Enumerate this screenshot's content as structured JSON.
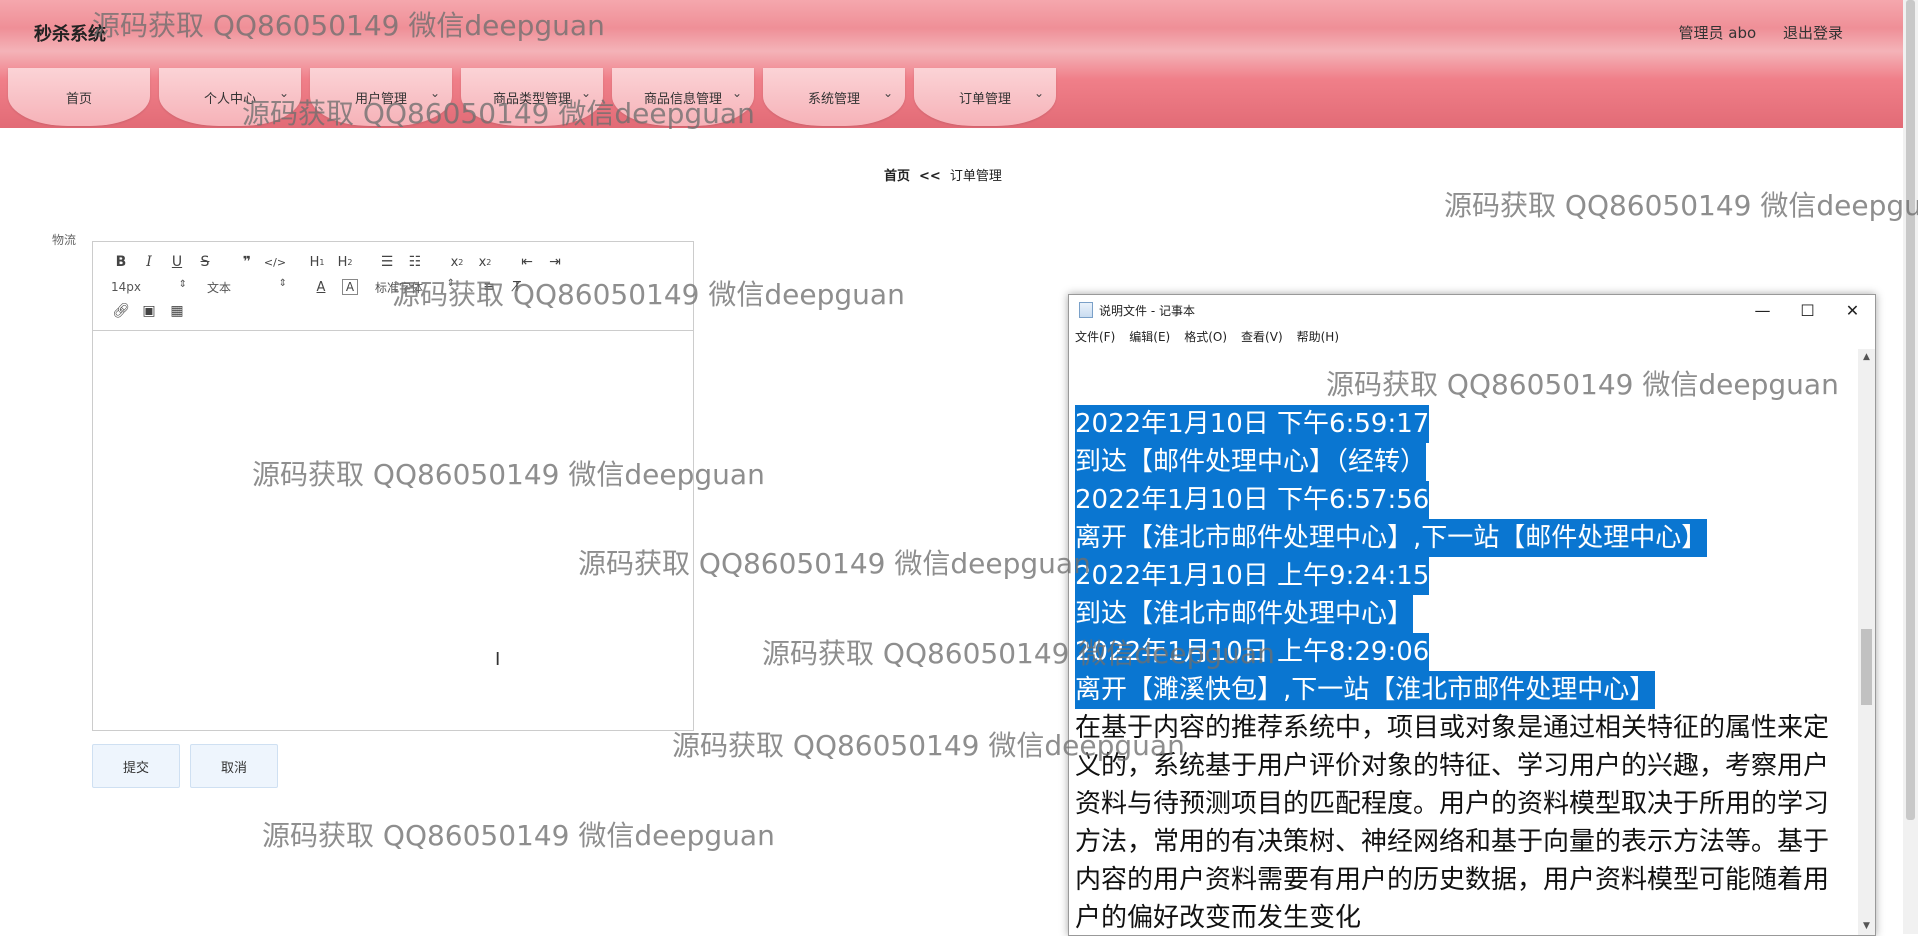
{
  "header": {
    "brand": "秒杀系统",
    "user_label": "管理员 abo",
    "logout_label": "退出登录"
  },
  "nav": [
    {
      "label": "首页",
      "has_dropdown": false
    },
    {
      "label": "个人中心",
      "has_dropdown": true
    },
    {
      "label": "用户管理",
      "has_dropdown": true
    },
    {
      "label": "商品类型管理",
      "has_dropdown": true
    },
    {
      "label": "商品信息管理",
      "has_dropdown": true
    },
    {
      "label": "系统管理",
      "has_dropdown": true
    },
    {
      "label": "订单管理",
      "has_dropdown": true
    }
  ],
  "breadcrumb": {
    "home": "首页",
    "separator": "<<",
    "current": "订单管理"
  },
  "form": {
    "field_label": "物流",
    "toolbar": {
      "font_size": "14px",
      "paragraph": "文本",
      "font_family": "标准字体",
      "icons": [
        "bold-icon",
        "italic-icon",
        "underline-icon",
        "strike-icon",
        "quote-icon",
        "code-icon",
        "h1-icon",
        "h2-icon",
        "ordered-list-icon",
        "bullet-list-icon",
        "subscript-icon",
        "superscript-icon",
        "outdent-icon",
        "indent-icon",
        "font-color-icon",
        "background-color-icon",
        "align-icon",
        "clean-icon",
        "link-icon",
        "image-icon",
        "video-icon"
      ]
    },
    "submit_label": "提交",
    "cancel_label": "取消"
  },
  "notepad": {
    "title": "说明文件 - 记事本",
    "menu": [
      "文件(F)",
      "编辑(E)",
      "格式(O)",
      "查看(V)",
      "帮助(H)"
    ],
    "selected_lines": [
      "2022年1月10日 下午6:59:17",
      "到达【邮件处理中心】（经转）",
      "2022年1月10日 下午6:57:56",
      "离开【淮北市邮件处理中心】,下一站【邮件处理中心】",
      "2022年1月10日 上午9:24:15",
      "到达【淮北市邮件处理中心】",
      "2022年1月10日 上午8:29:06",
      "离开【濉溪快包】,下一站【淮北市邮件处理中心】"
    ],
    "body_text": "在基于内容的推荐系统中，项目或对象是通过相关特征的属性来定义的，系统基于用户评价对象的特征、学习用户的兴趣，考察用户资料与待预测项目的匹配程度。用户的资料模型取决于所用的学习方法，常用的有决策树、神经网络和基于向量的表示方法等。基于内容的用户资料需要有用户的历史数据，用户资料模型可能随着用户的偏好改变而发生变化"
  },
  "watermark": "源码获取 QQ86050149 微信deepguan"
}
